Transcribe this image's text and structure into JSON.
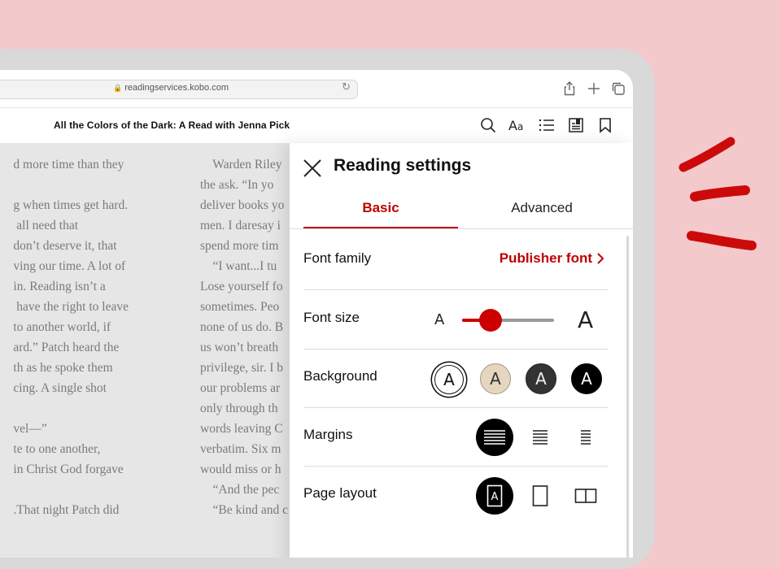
{
  "browser": {
    "url": "readingservices.kobo.com",
    "icons": [
      "lock-icon",
      "reload-icon",
      "share-icon",
      "new-tab-icon",
      "tabs-icon"
    ]
  },
  "reader": {
    "title": "All the Colors of the Dark: A Read with Jenna Pick",
    "icons": [
      "search-icon",
      "font-settings-icon",
      "table-of-contents-icon",
      "notes-icon",
      "bookmark-icon"
    ]
  },
  "page": {
    "col1": [
      "d more time than they",
      "",
      "g when times get hard.",
      " all need that",
      "don’t deserve it, that",
      "ving our time. A lot of",
      "in. Reading isn’t a",
      " have the right to leave",
      "to another world, if",
      "ard.” Patch heard the",
      "th as he spoke them",
      "cing. A single shot",
      "",
      "vel—”",
      "te to one another,",
      "in Christ God forgave",
      "",
      ".That night Patch did"
    ],
    "col2": [
      "    Warden Riley",
      "the ask. “In yo",
      "deliver books yo",
      "men. I daresay i",
      "spend more tim",
      "    “I want...I tu",
      "Lose yourself fo",
      "sometimes. Peo",
      "none of us do. B",
      "us won’t breath",
      "privilege, sir. I b",
      "our problems ar",
      "only through th",
      "words leaving C",
      "verbatim. Six m",
      "would miss or h",
      "    “And the pec",
      "    “Be kind and c"
    ]
  },
  "settings": {
    "title": "Reading settings",
    "tabs": {
      "basic": "Basic",
      "advanced": "Advanced",
      "active": "Basic"
    },
    "font_family": {
      "label": "Font family",
      "value": "Publisher font"
    },
    "font_size": {
      "label": "Font size",
      "small_glyph": "A",
      "large_glyph": "A",
      "level": 0.31
    },
    "background": {
      "label": "Background",
      "glyph": "A",
      "options": [
        "white",
        "sepia",
        "dark-gray",
        "black"
      ],
      "selected": "white"
    },
    "margins": {
      "label": "Margins",
      "options": [
        "wide",
        "medium",
        "narrow"
      ],
      "selected": "wide"
    },
    "page_layout": {
      "label": "Page layout",
      "options": [
        "auto",
        "single-page",
        "two-page"
      ],
      "selected": "auto"
    }
  },
  "colors": {
    "accent": "#bf0000",
    "background": "#f4c9cb",
    "page": "#e6e6e6"
  }
}
